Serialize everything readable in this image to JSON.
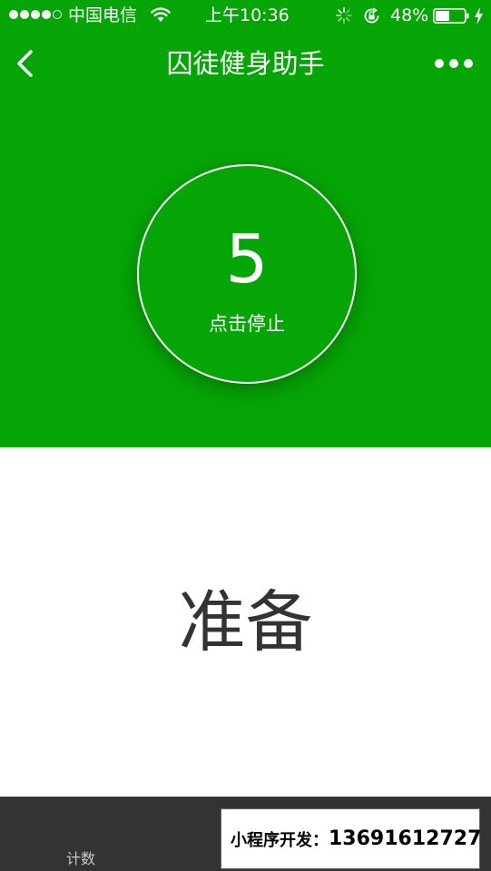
{
  "status_bar": {
    "carrier": "中国电信",
    "time": "上午10:36",
    "battery": "48%",
    "battery_level": 0.48,
    "icons": [
      "signal-dots",
      "wifi-icon",
      "spinner-icon",
      "lock-rotation-icon",
      "battery-icon",
      "charge-icon"
    ]
  },
  "nav": {
    "title": "囚徒健身助手",
    "back_icon": "chevron-left-icon",
    "more_icon": "more-dots-icon"
  },
  "timer": {
    "count": "5",
    "action_label": "点击停止"
  },
  "main": {
    "status": "准备"
  },
  "bottom": {
    "count_label": "计数",
    "dev_label": "小程序开发：",
    "dev_phone": "13691612727"
  },
  "colors": {
    "primary_green": "#05a505",
    "bottom_bar": "#333333",
    "text_dark": "#333333",
    "white": "#ffffff"
  }
}
